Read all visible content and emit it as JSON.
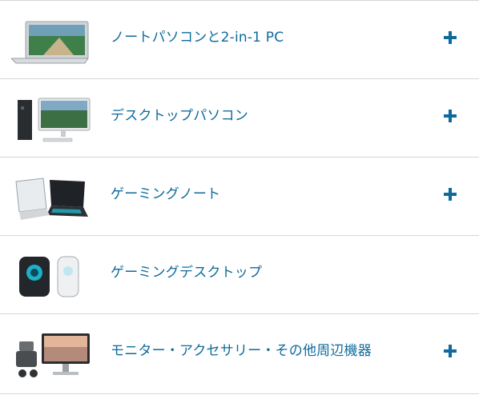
{
  "categories": [
    {
      "label": "ノートパソコンと2-in-1 PC",
      "icon": "laptop-icon",
      "expand_icon": "plus-icon"
    },
    {
      "label": "デスクトップパソコン",
      "icon": "desktop-icon",
      "expand_icon": "plus-icon"
    },
    {
      "label": "ゲーミングノート",
      "icon": "gaming-laptop-icon",
      "expand_icon": "plus-icon"
    },
    {
      "label": "ゲーミングデスクトップ",
      "icon": "gaming-desktop-icon",
      "expand_icon": ""
    },
    {
      "label": "モニター・アクセサリー・その他周辺機器",
      "icon": "monitor-accessories-icon",
      "expand_icon": "plus-icon"
    }
  ],
  "colors": {
    "link_text": "#0e6a9c",
    "plus": "#0e6a9c",
    "divider": "#d6d6d6"
  }
}
